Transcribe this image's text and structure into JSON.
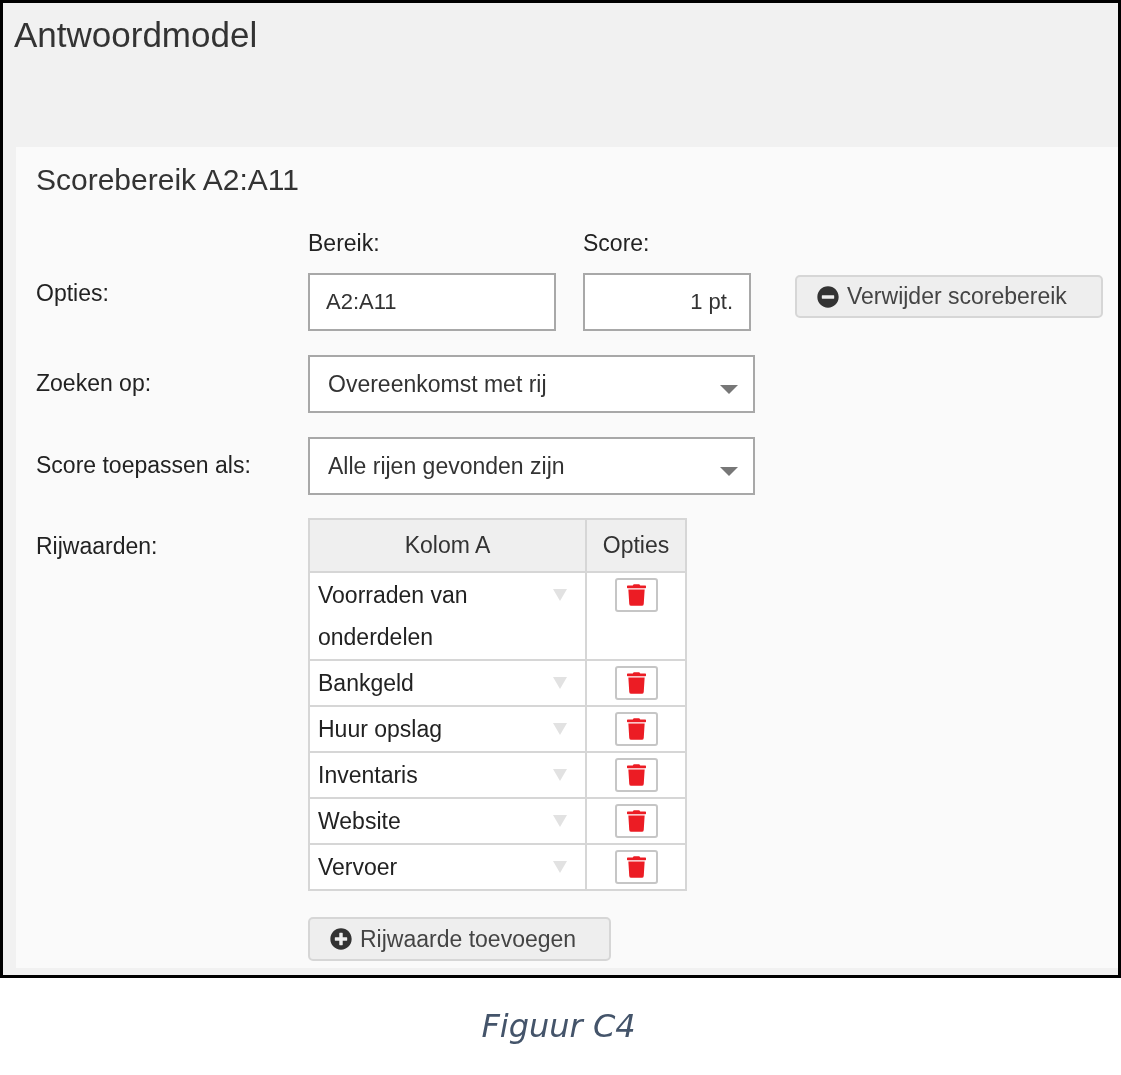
{
  "header": {
    "title": "Antwoordmodel"
  },
  "panel": {
    "title": "Scorebereik A2:A11",
    "options": {
      "label": "Opties:",
      "range": {
        "label": "Bereik:",
        "value": "A2:A11"
      },
      "score": {
        "label": "Score:",
        "value": "1 pt."
      },
      "remove_button": "Verwijder scorebereik"
    },
    "search_by": {
      "label": "Zoeken op:",
      "value": "Overeenkomst met rij"
    },
    "apply_score": {
      "label": "Score toepassen als:",
      "value": "Alle rijen gevonden zijn"
    },
    "row_values": {
      "label": "Rijwaarden:",
      "columns": [
        "Kolom A",
        "Opties"
      ],
      "rows": [
        {
          "value": "Voorraden van onderdelen"
        },
        {
          "value": "Bankgeld"
        },
        {
          "value": "Huur opslag"
        },
        {
          "value": "Inventaris"
        },
        {
          "value": "Website"
        },
        {
          "value": "Vervoer"
        }
      ]
    },
    "add_button": "Rijwaarde toevoegen"
  },
  "caption": "Figuur C4"
}
